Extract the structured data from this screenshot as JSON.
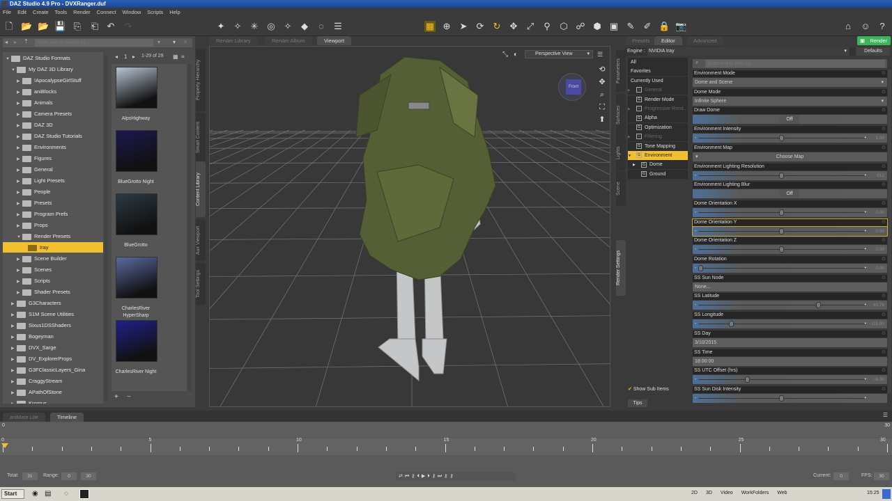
{
  "window": {
    "title": "DAZ Studio 4.9 Pro - DVXRanger.duf",
    "icon": "DS"
  },
  "menu": [
    "File",
    "Edit",
    "Create",
    "Tools",
    "Render",
    "Connect",
    "Window",
    "Scripts",
    "Help"
  ],
  "content_library": {
    "search_placeholder": "Enter text to search by...",
    "page": "1",
    "page_range": "1-29 of 29",
    "tree": [
      {
        "label": "DAZ Studio Formats",
        "level": 0,
        "open": true
      },
      {
        "label": "My DAZ 3D Library",
        "level": 1,
        "open": true
      },
      {
        "label": "!ApocalypseGirlStuff",
        "level": 2
      },
      {
        "label": "aniBlocks",
        "level": 2
      },
      {
        "label": "Animals",
        "level": 2
      },
      {
        "label": "Camera Presets",
        "level": 2
      },
      {
        "label": "DAZ 3D",
        "level": 2
      },
      {
        "label": "DAZ Studio Tutorials",
        "level": 2
      },
      {
        "label": "Environments",
        "level": 2
      },
      {
        "label": "Figures",
        "level": 2
      },
      {
        "label": "General",
        "level": 2
      },
      {
        "label": "Light Presets",
        "level": 2
      },
      {
        "label": "People",
        "level": 2
      },
      {
        "label": "Presets",
        "level": 2
      },
      {
        "label": "Program Prefs",
        "level": 2
      },
      {
        "label": "Props",
        "level": 2
      },
      {
        "label": "Render Presets",
        "level": 2,
        "open": true
      },
      {
        "label": "Iray",
        "level": 3,
        "selected": true
      },
      {
        "label": "Scene Builder",
        "level": 2
      },
      {
        "label": "Scenes",
        "level": 2
      },
      {
        "label": "Scripts",
        "level": 2
      },
      {
        "label": "Shader Presets",
        "level": 2
      },
      {
        "label": "G3Characters",
        "level": 1
      },
      {
        "label": "S1M Scene Utilities",
        "level": 1
      },
      {
        "label": "Sixus1DSShaders",
        "level": 1
      },
      {
        "label": "Bogeyman",
        "level": 1
      },
      {
        "label": "DVX_Sarge",
        "level": 1
      },
      {
        "label": "DV_ExplorerProps",
        "level": 1
      },
      {
        "label": "G3FClassicLayers_Gina",
        "level": 1
      },
      {
        "label": "CraggyStream",
        "level": 1
      },
      {
        "label": "APathOfStone",
        "level": 1
      },
      {
        "label": "Kromus",
        "level": 1
      }
    ],
    "thumbnails": [
      {
        "label": "AlpsHighway",
        "color": "#b8c4d4"
      },
      {
        "label": "BlueGrotto Night",
        "color": "#1c1850"
      },
      {
        "label": "BlueGrotto",
        "color": "#2c3a44"
      },
      {
        "label": "CharlesRiver HyperSharp",
        "color": "#5a6aa0"
      },
      {
        "label": "CharlesRiver Night",
        "color": "#20208a"
      }
    ],
    "vertical_tabs": [
      "Property Hierarchy",
      "Smart Content",
      "Content Library",
      "Aux Viewport",
      "Tool Settings"
    ]
  },
  "viewport": {
    "tabs": [
      "Render Library",
      "Render Album",
      "Viewport"
    ],
    "active_tab": "Viewport",
    "camera": "Perspective View",
    "cube_label": "Front"
  },
  "render_settings": {
    "tabs": [
      "Presets",
      "Editor",
      "Advanced"
    ],
    "active_tab": "Editor",
    "render_button": "Render",
    "engine_label": "Engine :",
    "engine": "NVIDIA Iray",
    "defaults_button": "Defaults",
    "filter_placeholder": "Enter text to filter by...",
    "show_sub_items": "Show Sub Items",
    "tips": "Tips",
    "vertical_tabs": [
      "Parameters",
      "Surfaces",
      "Lights",
      "Scene",
      "Render Settings"
    ],
    "categories": [
      {
        "label": "All"
      },
      {
        "label": "Favorites"
      },
      {
        "label": "Currently Used"
      },
      {
        "label": "General",
        "group": true,
        "dim": true,
        "arrow": true
      },
      {
        "label": "Render Mode",
        "group": true
      },
      {
        "label": "Progressive Rend...",
        "group": true,
        "dim": true,
        "arrow": true
      },
      {
        "label": "Alpha",
        "group": true
      },
      {
        "label": "Optimization",
        "group": true
      },
      {
        "label": "Filtering",
        "group": true,
        "dim": true,
        "arrow": true
      },
      {
        "label": "Tone Mapping",
        "group": true
      },
      {
        "label": "Environment",
        "group": true,
        "selected": true,
        "arrow": true
      },
      {
        "label": "Dome",
        "group": true,
        "sub": true,
        "arrow": true
      },
      {
        "label": "Ground",
        "group": true,
        "sub": true
      }
    ],
    "properties": [
      {
        "label": "Environment Mode",
        "type": "dropdown",
        "value": "Dome and Scene"
      },
      {
        "label": "Dome Mode",
        "type": "dropdown",
        "value": "Infinite Sphere"
      },
      {
        "label": "Draw Dome",
        "type": "toggle",
        "value": "Off"
      },
      {
        "label": "Environment Intensity",
        "type": "slider",
        "value": "1.00",
        "pos": 0.5
      },
      {
        "label": "Environment Map",
        "type": "button",
        "value": "Choose Map"
      },
      {
        "label": "Environment Lighting Resolution",
        "type": "slider",
        "value": "512",
        "pos": 0.5
      },
      {
        "label": "Environment Lighting Blur",
        "type": "toggle",
        "value": "Off"
      },
      {
        "label": "Dome Orientation X",
        "type": "slider",
        "value": "0.00",
        "pos": 0.5
      },
      {
        "label": "Dome Orientation Y",
        "type": "slider",
        "value": "0.00",
        "pos": 0.5,
        "highlight": true
      },
      {
        "label": "Dome Orientation Z",
        "type": "slider",
        "value": "0.00",
        "pos": 0.5
      },
      {
        "label": "Dome Rotation",
        "type": "slider",
        "value": "0.00",
        "pos": 0.0
      },
      {
        "label": "SS Sun Node",
        "type": "field",
        "value": "None..."
      },
      {
        "label": "SS Latitude",
        "type": "slider",
        "value": "40.76",
        "pos": 0.73
      },
      {
        "label": "SS Longitude",
        "type": "slider",
        "value": "-111.90",
        "pos": 0.19
      },
      {
        "label": "SS Day",
        "type": "field",
        "value": "3/10/2015"
      },
      {
        "label": "SS Time",
        "type": "field",
        "value": "18:00:00"
      },
      {
        "label": "SS UTC Offset (hrs)",
        "type": "slider",
        "value": "-6.00",
        "pos": 0.29
      },
      {
        "label": "SS Sun Disk Intensity",
        "type": "slider",
        "value": "",
        "pos": 0.5
      }
    ]
  },
  "timeline": {
    "tabs": [
      "aniMate Lite",
      "Timeline"
    ],
    "active_tab": "Timeline",
    "ticks": [
      "0",
      "5",
      "10",
      "15",
      "20",
      "25",
      "30"
    ],
    "start": "0",
    "end": "30",
    "total_label": "Total:",
    "total": "31",
    "range_label": "Range:",
    "range_start": "0",
    "range_end": "30",
    "current_label": "Current:",
    "current": "0",
    "fps_label": "FPS:",
    "fps": "30"
  },
  "taskbar": {
    "start": "Start",
    "toolbars": [
      "2D",
      "3D",
      "Video",
      "WorkFolders",
      "Web"
    ],
    "clock": "15:25"
  }
}
